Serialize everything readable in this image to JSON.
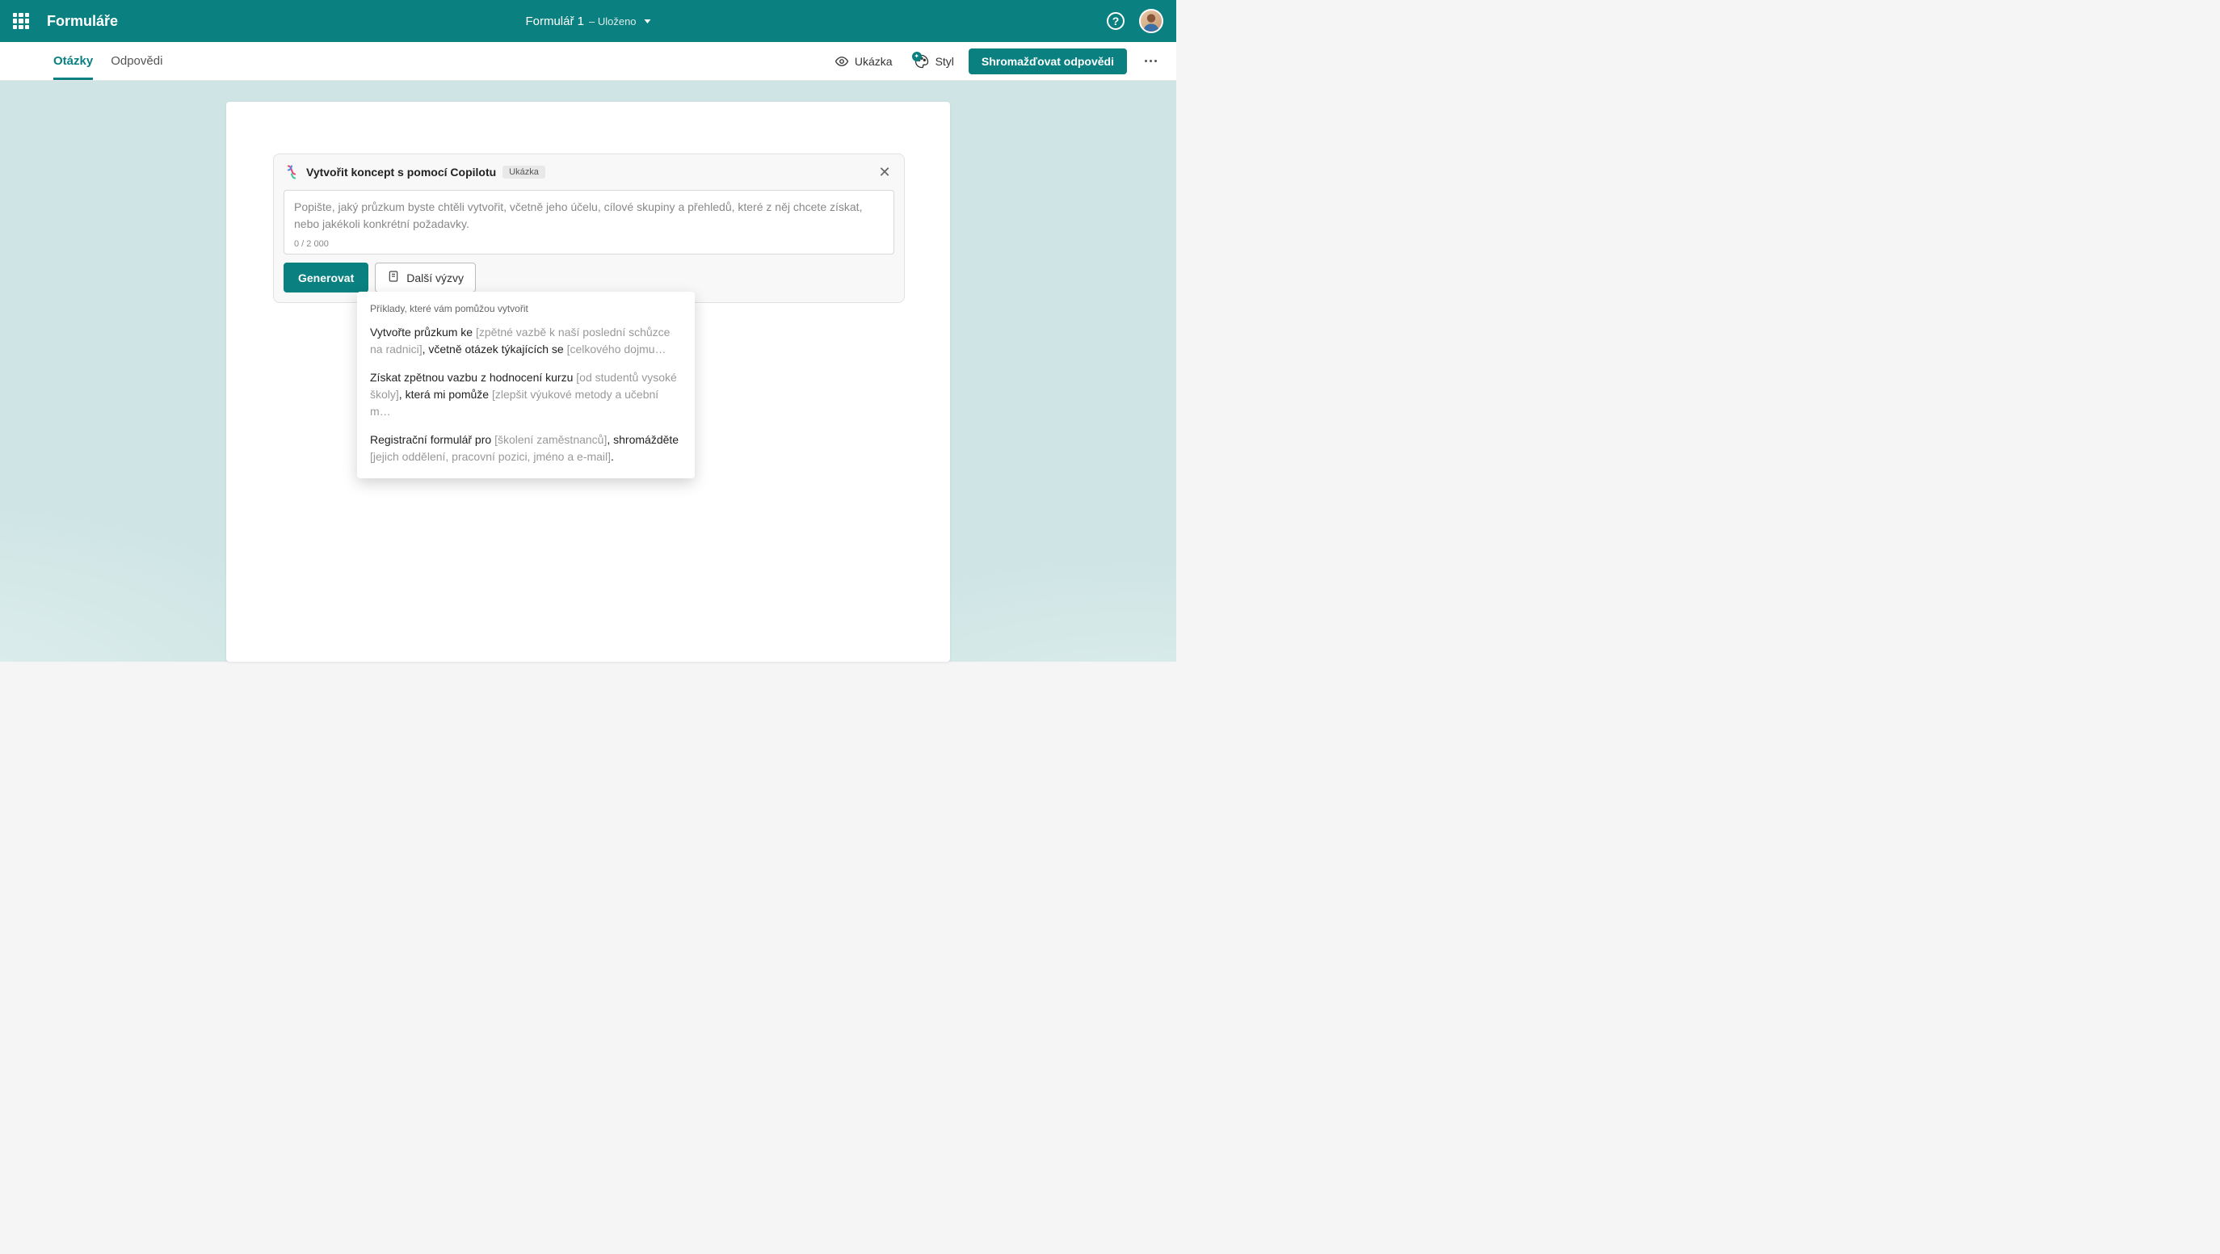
{
  "header": {
    "app_name": "Formuláře",
    "form_title": "Formulář 1",
    "form_status": "– Uloženo",
    "help_char": "?"
  },
  "toolbar": {
    "tabs": [
      "Otázky",
      "Odpovědi"
    ],
    "active_tab_index": 0,
    "preview_label": "Ukázka",
    "style_label": "Styl",
    "collect_label": "Shromažďovat odpovědi"
  },
  "copilot": {
    "title": "Vytvořit koncept s pomocí Copilotu",
    "badge": "Ukázka",
    "placeholder": "Popište, jaký průzkum byste chtěli vytvořit, včetně jeho účelu, cílové skupiny a přehledů, které z něj chcete získat, nebo jakékoli konkrétní požadavky.",
    "counter": "0 / 2 000",
    "generate_label": "Generovat",
    "more_prompts_label": "Další výzvy"
  },
  "prompts_panel": {
    "heading": "Příklady, které vám pomůžou vytvořit",
    "items": [
      {
        "parts": [
          {
            "t": "Vytvořte průzkum ke ",
            "m": false
          },
          {
            "t": "[zpětné vazbě k naší poslední schůzce na radnici]",
            "m": true
          },
          {
            "t": ", včetně otázek týkajících se ",
            "m": false
          },
          {
            "t": "[celkového dojmu…",
            "m": true
          }
        ]
      },
      {
        "parts": [
          {
            "t": "Získat zpětnou vazbu z hodnocení kurzu ",
            "m": false
          },
          {
            "t": "[od studentů vysoké školy]",
            "m": true
          },
          {
            "t": ", která mi pomůže ",
            "m": false
          },
          {
            "t": "[zlepšit výukové metody a učební m…",
            "m": true
          }
        ]
      },
      {
        "parts": [
          {
            "t": "Registrační formulář pro ",
            "m": false
          },
          {
            "t": "[školení zaměstnanců]",
            "m": true
          },
          {
            "t": ", shromážděte ",
            "m": false
          },
          {
            "t": "[jejich oddělení, pracovní pozici, jméno a e-mail]",
            "m": true
          },
          {
            "t": ".",
            "m": false
          }
        ]
      }
    ]
  }
}
